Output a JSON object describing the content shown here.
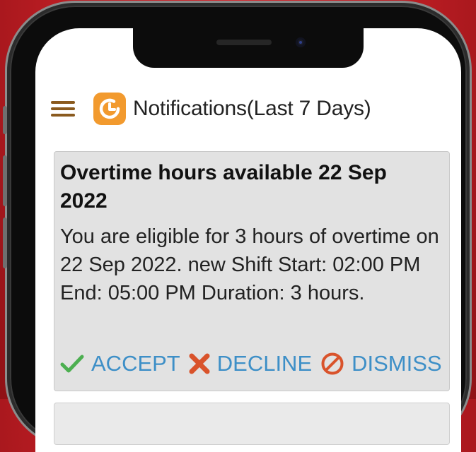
{
  "header": {
    "title": "Notifications(Last 7 Days)"
  },
  "notification": {
    "title": "Overtime hours available 22 Sep 2022",
    "body": "You are eligible for 3 hours of overtime on 22 Sep 2022. new Shift Start: 02:00 PM End: 05:00 PM Duration: 3 hours.",
    "actions": {
      "accept": "ACCEPT",
      "decline": "DECLINE",
      "dismiss": "DISMISS"
    }
  },
  "colors": {
    "accent": "#3d8fc7",
    "accept_icon": "#4caf50",
    "decline_icon": "#d9532b",
    "dismiss_icon": "#d9532b",
    "logo": "#f29a2e",
    "menu_icon": "#8a5a1e",
    "card_bg": "#e2e2e2",
    "background": "#c0202a"
  },
  "icons": {
    "menu": "hamburger-menu-icon",
    "logo": "clock-app-logo",
    "accept": "checkmark-icon",
    "decline": "x-cross-icon",
    "dismiss": "prohibited-circle-icon"
  }
}
